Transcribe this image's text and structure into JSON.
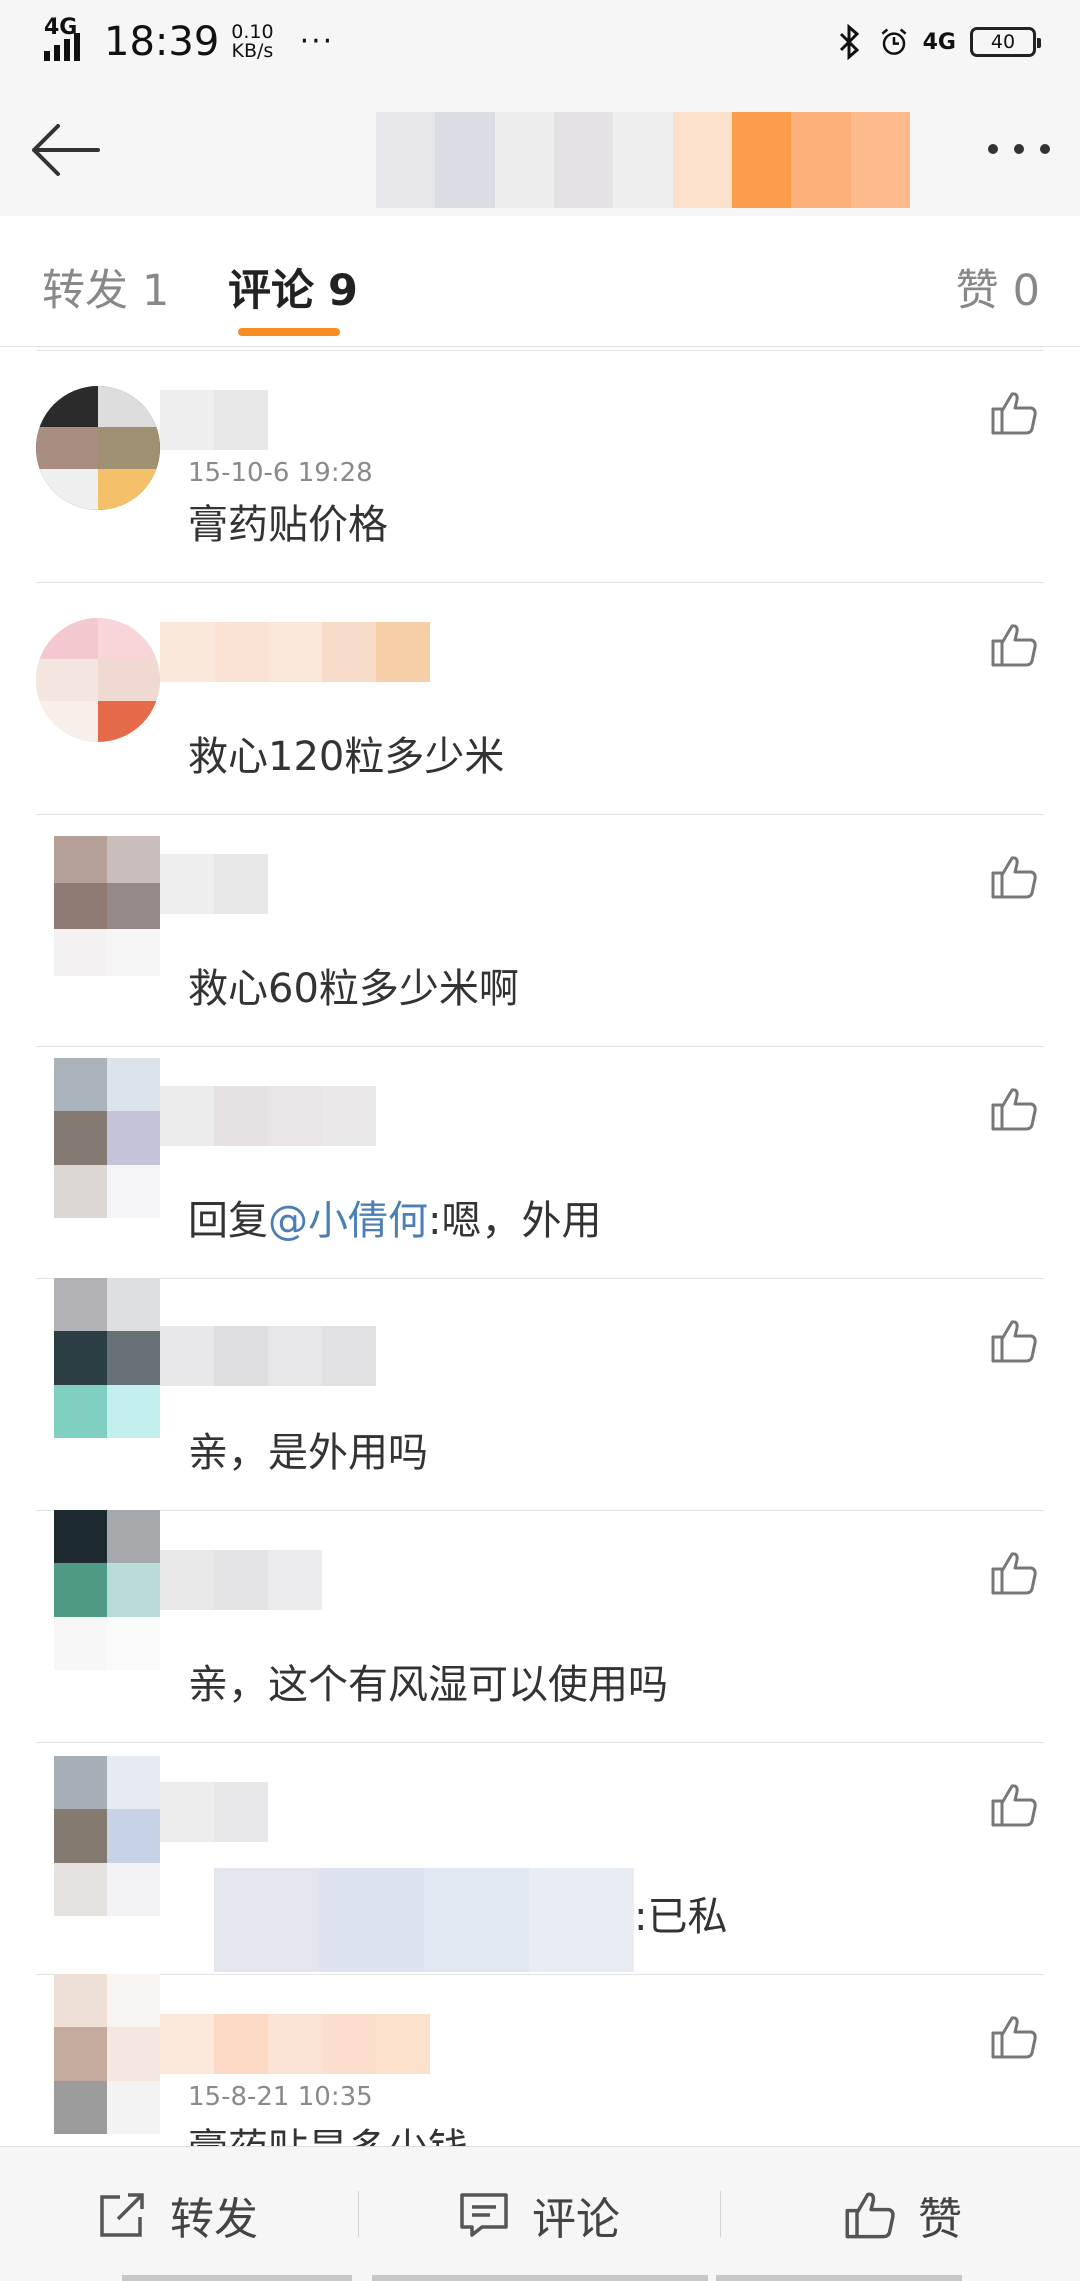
{
  "status_bar": {
    "network_left": "4G",
    "time": "18:39",
    "net_speed_value": "0.10",
    "net_speed_unit": "KB/s",
    "more": "···",
    "network_right": "4G",
    "battery": "40"
  },
  "header": {
    "back_icon": "back-arrow-icon",
    "more_icon": "more-dots-icon"
  },
  "tabs": [
    {
      "label": "转发",
      "count": "1"
    },
    {
      "label": "评论",
      "count": "9"
    },
    {
      "label": "赞",
      "count": "0"
    }
  ],
  "comments": [
    {
      "meta": "15-10-6 19:28",
      "text": "膏药贴价格"
    },
    {
      "meta": "",
      "text": "救心120粒多少米"
    },
    {
      "meta": "",
      "text": "救心60粒多少米啊"
    },
    {
      "meta": "",
      "text_prefix": "回复",
      "mention": "@小倩何",
      "text_suffix": ":嗯，外用"
    },
    {
      "meta": "",
      "text": "亲，是外用吗"
    },
    {
      "meta": "",
      "text": "亲，这个有风湿可以使用吗"
    },
    {
      "meta": "",
      "text": ":已私"
    },
    {
      "meta": "15-8-21 10:35",
      "text": "膏药贴是多少钱"
    }
  ],
  "bottom_bar": {
    "repost": "转发",
    "comment": "评论",
    "like": "赞"
  },
  "colors": {
    "accent": "#f78c22",
    "mention": "#4b7fb6"
  }
}
